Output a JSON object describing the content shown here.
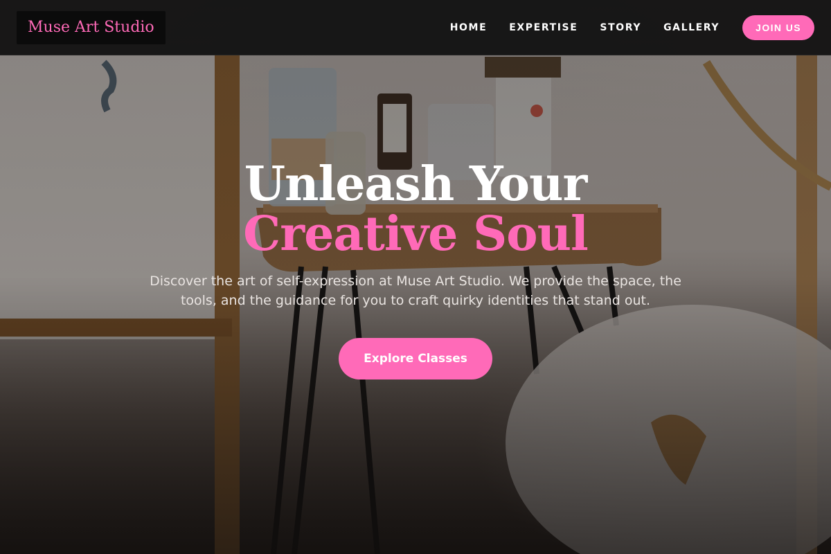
{
  "brand": {
    "name": "Muse Art Studio",
    "accent_color": "#ff6ab8"
  },
  "nav": {
    "links": [
      {
        "label": "HOME"
      },
      {
        "label": "EXPERTISE"
      },
      {
        "label": "STORY"
      },
      {
        "label": "GALLERY"
      }
    ],
    "cta_label": "JOIN US"
  },
  "hero": {
    "title_plain": "Unleash Your",
    "title_accent": "Creative Soul",
    "subtitle": "Discover the art of self-expression at Muse Art Studio. We provide the space, the tools, and the guidance for you to craft quirky identities that stand out.",
    "cta_label": "Explore Classes",
    "background_image": "art-studio-table-with-supplies-photo"
  }
}
